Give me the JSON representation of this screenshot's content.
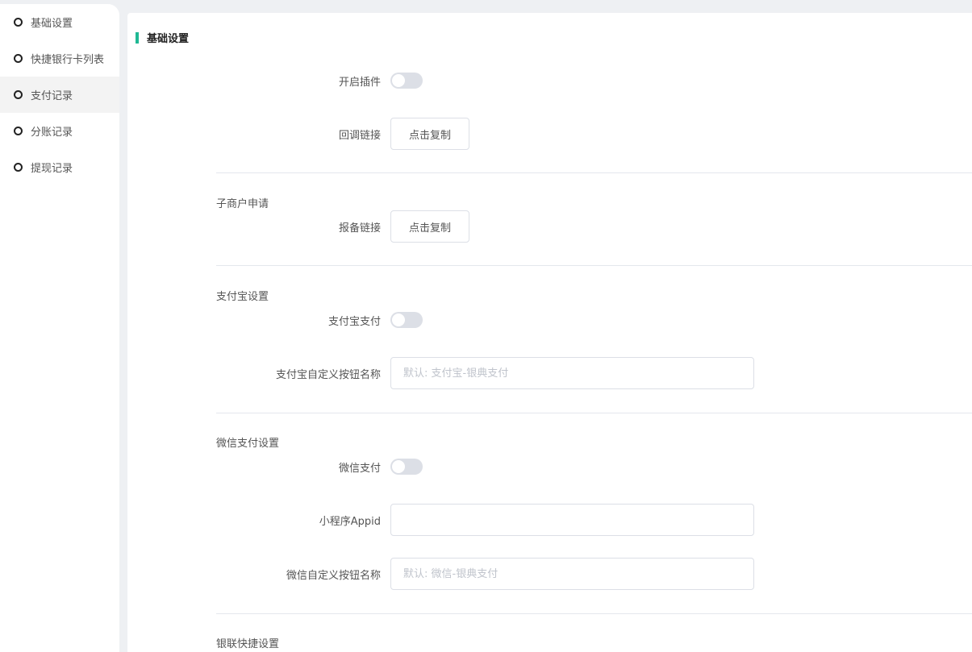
{
  "sidebar": {
    "items": [
      {
        "label": "基础设置"
      },
      {
        "label": "快捷银行卡列表"
      },
      {
        "label": "支付记录"
      },
      {
        "label": "分账记录"
      },
      {
        "label": "提现记录"
      }
    ]
  },
  "main": {
    "title": "基础设置",
    "enable_plugin": {
      "label": "开启插件",
      "on": false
    },
    "callback_link": {
      "label": "回调链接",
      "button": "点击复制"
    },
    "submerchant": {
      "section": "子商户申请",
      "label": "报备链接",
      "button": "点击复制"
    },
    "alipay": {
      "section": "支付宝设置",
      "toggle_label": "支付宝支付",
      "on": false,
      "name_label": "支付宝自定义按钮名称",
      "name_placeholder": "默认: 支付宝-银典支付"
    },
    "wechat": {
      "section": "微信支付设置",
      "toggle_label": "微信支付",
      "on": false,
      "appid_label": "小程序Appid",
      "appid_value": "",
      "name_label": "微信自定义按钮名称",
      "name_placeholder": "默认: 微信-银典支付"
    },
    "unionpay": {
      "section": "银联快捷设置"
    }
  },
  "colors": {
    "accent": "#1fb894"
  }
}
